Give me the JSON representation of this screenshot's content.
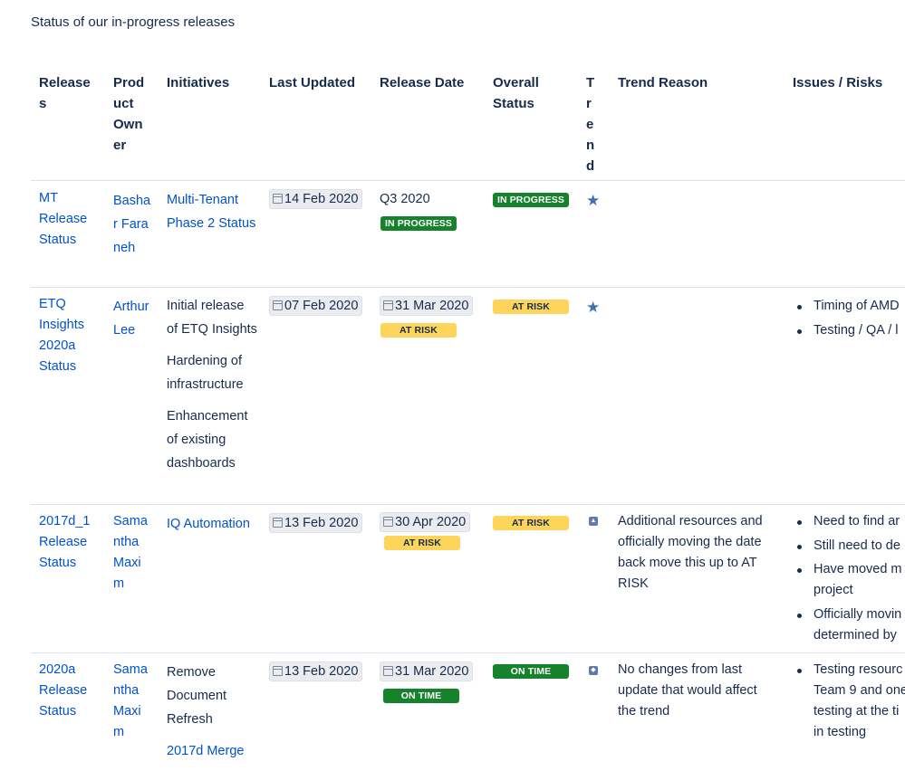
{
  "caption": "Status of our in-progress releases",
  "headers": {
    "releases": "Releases",
    "product_owner": "Product Owner",
    "initiatives": "Initiatives",
    "last_updated": "Last Updated",
    "release_date": "Release Date",
    "overall_status": "Overall Status",
    "trend": "Trend",
    "trend_reason": "Trend Reason",
    "issues_risks": "Issues / Risks"
  },
  "rows": [
    {
      "release": "MT Release Status",
      "owner": "Bashar Faraneh",
      "initiatives": [
        "Multi-Tenant Phase 2 Status"
      ],
      "last_updated": "14 Feb 2020",
      "release_date": "Q3 2020",
      "release_lozenge": "IN PROGRESS",
      "overall_status": "IN PROGRESS",
      "trend_icon": "star-icon",
      "trend_reason": "",
      "risks": []
    },
    {
      "release": "ETQ Insights 2020a Status",
      "owner": "Arthur Lee",
      "initiatives": [
        "Initial release of ETQ Insights",
        "Hardening of infrastructure",
        "Enhancement of existing dashboards"
      ],
      "last_updated": "07 Feb 2020",
      "release_date": "31 Mar 2020",
      "release_lozenge": "AT RISK",
      "overall_status": "AT RISK",
      "trend_icon": "star-icon",
      "trend_reason": "",
      "risks": [
        "Timing of AMD",
        "Testing / QA / l"
      ]
    },
    {
      "release": "2017d_1 Release Status",
      "owner": "Samantha Maxim",
      "initiatives": [
        "IQ Automation"
      ],
      "last_updated": "13 Feb 2020",
      "release_date": "30 Apr 2020",
      "release_lozenge": "AT RISK",
      "overall_status": "AT RISK",
      "trend_icon": "arrow-up-icon",
      "trend_reason": "Additional resources and officially moving the date back move this up to AT RISK",
      "risks": [
        "Need to find ar",
        "Still need to de",
        "Have moved m",
        "project",
        "Officially movin",
        "determined by"
      ]
    },
    {
      "release": "2020a Release Status",
      "owner": "Samantha Maxim",
      "initiatives": [
        "Remove Document Refresh",
        "2017d Merge"
      ],
      "last_updated": "13 Feb 2020",
      "release_date": "31 Mar 2020",
      "release_lozenge": "ON TIME",
      "overall_status": "ON TIME",
      "trend_icon": "flat-arrow-icon",
      "trend_reason": "No changes from last update that would affect the trend",
      "risks": [
        "Testing resourc",
        "Team 9 and one",
        "testing at the ti",
        "in testing"
      ]
    }
  ],
  "colors": {
    "link": "#0052cc",
    "text": "#172b4d",
    "green_lozenge": "#16822b",
    "yellow_lozenge": "#fcd55a",
    "trend_icon": "#3f6fb5"
  }
}
